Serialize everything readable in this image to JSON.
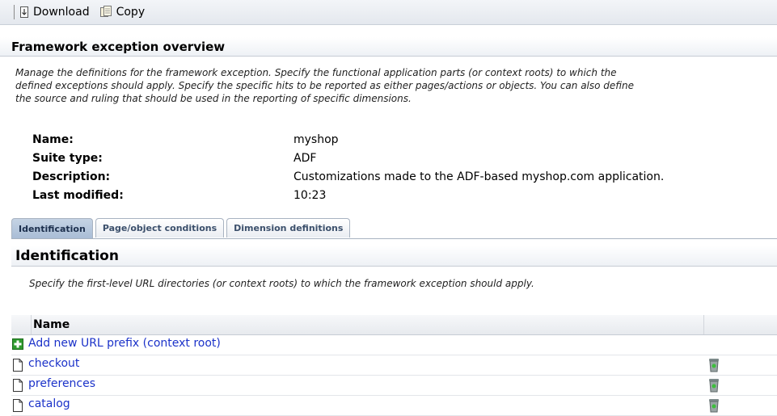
{
  "toolbar": {
    "download_label": "Download",
    "copy_label": "Copy"
  },
  "overview": {
    "title": "Framework exception overview",
    "description_lines": [
      "Manage the definitions for the framework exception. Specify the functional application parts (or context roots) to which the",
      "defined exceptions should apply. Specify the specific hits to be reported as either pages/actions or objects. You can also define",
      "the source and ruling that should be used in the reporting of specific dimensions."
    ]
  },
  "properties": [
    {
      "label": "Name:",
      "value": "myshop"
    },
    {
      "label": "Suite type:",
      "value": "ADF"
    },
    {
      "label": "Description:",
      "value": "Customizations made to the ADF-based myshop.com application."
    },
    {
      "label": "Last modified:",
      "value": "10:23"
    }
  ],
  "tabs": [
    {
      "label": "Identification",
      "active": true
    },
    {
      "label": "Page/object conditions",
      "active": false
    },
    {
      "label": "Dimension definitions",
      "active": false
    }
  ],
  "identification": {
    "title": "Identification",
    "description": "Specify the first-level URL directories (or context roots) to which the framework exception should apply."
  },
  "table": {
    "column_name": "Name",
    "add_label": "Add new URL prefix (context root)",
    "rows": [
      "checkout",
      "preferences",
      "catalog"
    ]
  },
  "colors": {
    "link": "#1b32c9",
    "active_tab": "#a9bdd6"
  }
}
